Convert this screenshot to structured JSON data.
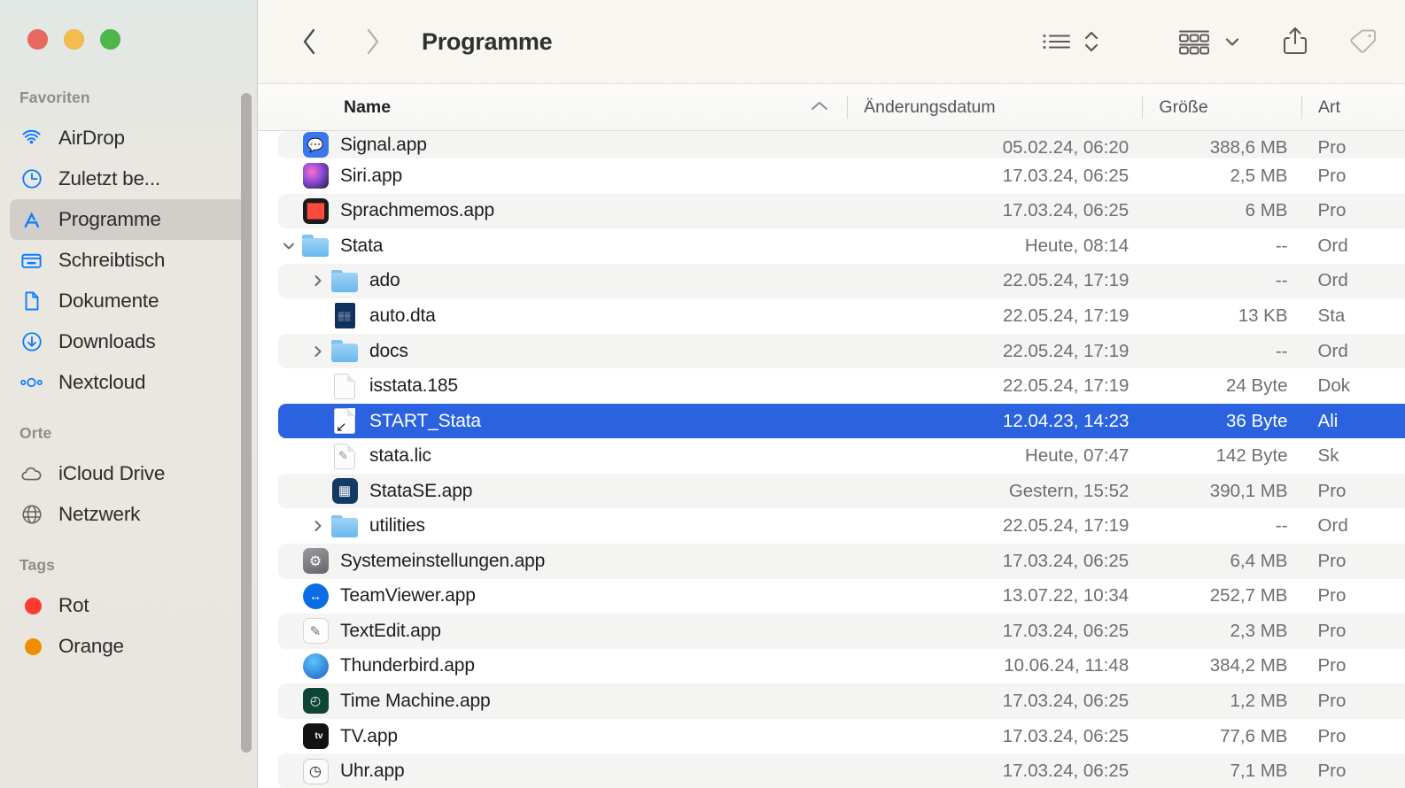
{
  "window": {
    "traffic_lights": [
      "close",
      "minimize",
      "zoom"
    ],
    "accent_selection_color": "#2a62e0",
    "sidebar_bg": "#e9e6e0",
    "toolbar_bg": "#f8f6f1"
  },
  "toolbar": {
    "back_icon": "chevron-left",
    "forward_icon": "chevron-right",
    "title": "Programme",
    "view_list_icon": "list-view-icon",
    "sort_icon": "chevron-up-down-icon",
    "group_icon": "group-by-grid-icon",
    "group_dropdown_icon": "chevron-down-icon",
    "share_icon": "share-icon",
    "tag_icon": "tag-icon"
  },
  "sidebar": {
    "sections": [
      {
        "title": "Favoriten",
        "items": [
          {
            "label": "AirDrop",
            "icon": "airdrop-icon",
            "selected": false
          },
          {
            "label": "Zuletzt be...",
            "icon": "recents-clock-icon",
            "selected": false
          },
          {
            "label": "Programme",
            "icon": "applications-icon",
            "selected": true
          },
          {
            "label": "Schreibtisch",
            "icon": "desktop-icon",
            "selected": false
          },
          {
            "label": "Dokumente",
            "icon": "documents-icon",
            "selected": false
          },
          {
            "label": "Downloads",
            "icon": "downloads-icon",
            "selected": false
          },
          {
            "label": "Nextcloud",
            "icon": "nextcloud-icon",
            "selected": false
          }
        ]
      },
      {
        "title": "Orte",
        "items": [
          {
            "label": "iCloud Drive",
            "icon": "cloud-icon",
            "selected": false
          },
          {
            "label": "Netzwerk",
            "icon": "globe-icon",
            "selected": false
          }
        ]
      },
      {
        "title": "Tags",
        "items": [
          {
            "label": "Rot",
            "icon": "tag-dot",
            "color": "#fb3b30",
            "selected": false
          },
          {
            "label": "Orange",
            "icon": "tag-dot",
            "color": "#ef8f00",
            "selected": false
          }
        ]
      }
    ]
  },
  "columns": {
    "name": "Name",
    "date": "Änderungsdatum",
    "size": "Größe",
    "kind": "Art",
    "sort_column": "Name",
    "sort_direction": "ascending"
  },
  "files": [
    {
      "name": "Signal.app",
      "date": "05.02.24, 06:20",
      "size": "388,6 MB",
      "kind": "Pro",
      "icon": "signal-app-icon",
      "indent": 0,
      "disclosure": "none",
      "selected": false,
      "clipped": true
    },
    {
      "name": "Siri.app",
      "date": "17.03.24, 06:25",
      "size": "2,5 MB",
      "kind": "Pro",
      "icon": "siri-app-icon",
      "indent": 0,
      "disclosure": "none",
      "selected": false,
      "clipped": false
    },
    {
      "name": "Sprachmemos.app",
      "date": "17.03.24, 06:25",
      "size": "6 MB",
      "kind": "Pro",
      "icon": "voicememos-app-icon",
      "indent": 0,
      "disclosure": "none",
      "selected": false,
      "clipped": false
    },
    {
      "name": "Stata",
      "date": "Heute, 08:14",
      "size": "--",
      "kind": "Ord",
      "icon": "folder-icon",
      "indent": 0,
      "disclosure": "expanded",
      "selected": false,
      "clipped": false
    },
    {
      "name": "ado",
      "date": "22.05.24, 17:19",
      "size": "--",
      "kind": "Ord",
      "icon": "folder-icon",
      "indent": 1,
      "disclosure": "collapsed",
      "selected": false,
      "clipped": false
    },
    {
      "name": "auto.dta",
      "date": "22.05.24, 17:19",
      "size": "13 KB",
      "kind": "Sta",
      "icon": "stata-data-icon",
      "indent": 1,
      "disclosure": "none",
      "selected": false,
      "clipped": false
    },
    {
      "name": "docs",
      "date": "22.05.24, 17:19",
      "size": "--",
      "kind": "Ord",
      "icon": "folder-icon",
      "indent": 1,
      "disclosure": "collapsed",
      "selected": false,
      "clipped": false
    },
    {
      "name": "isstata.185",
      "date": "22.05.24, 17:19",
      "size": "24 Byte",
      "kind": "Dok",
      "icon": "blank-document-icon",
      "indent": 1,
      "disclosure": "none",
      "selected": false,
      "clipped": false
    },
    {
      "name": "START_Stata",
      "date": "12.04.23, 14:23",
      "size": "36 Byte",
      "kind": "Ali",
      "icon": "alias-document-icon",
      "indent": 1,
      "disclosure": "none",
      "selected": true,
      "clipped": false
    },
    {
      "name": "stata.lic",
      "date": "Heute, 07:47",
      "size": "142 Byte",
      "kind": "Sk",
      "icon": "script-document-icon",
      "indent": 1,
      "disclosure": "none",
      "selected": false,
      "clipped": false
    },
    {
      "name": "StataSE.app",
      "date": "Gestern, 15:52",
      "size": "390,1 MB",
      "kind": "Pro",
      "icon": "statase-app-icon",
      "indent": 1,
      "disclosure": "none",
      "selected": false,
      "clipped": false
    },
    {
      "name": "utilities",
      "date": "22.05.24, 17:19",
      "size": "--",
      "kind": "Ord",
      "icon": "folder-icon",
      "indent": 1,
      "disclosure": "collapsed",
      "selected": false,
      "clipped": false
    },
    {
      "name": "Systemeinstellungen.app",
      "date": "17.03.24, 06:25",
      "size": "6,4 MB",
      "kind": "Pro",
      "icon": "settings-app-icon",
      "indent": 0,
      "disclosure": "none",
      "selected": false,
      "clipped": false
    },
    {
      "name": "TeamViewer.app",
      "date": "13.07.22, 10:34",
      "size": "252,7 MB",
      "kind": "Pro",
      "icon": "teamviewer-app-icon",
      "indent": 0,
      "disclosure": "none",
      "selected": false,
      "clipped": false
    },
    {
      "name": "TextEdit.app",
      "date": "17.03.24, 06:25",
      "size": "2,3 MB",
      "kind": "Pro",
      "icon": "textedit-app-icon",
      "indent": 0,
      "disclosure": "none",
      "selected": false,
      "clipped": false
    },
    {
      "name": "Thunderbird.app",
      "date": "10.06.24, 11:48",
      "size": "384,2 MB",
      "kind": "Pro",
      "icon": "thunderbird-app-icon",
      "indent": 0,
      "disclosure": "none",
      "selected": false,
      "clipped": false
    },
    {
      "name": "Time Machine.app",
      "date": "17.03.24, 06:25",
      "size": "1,2 MB",
      "kind": "Pro",
      "icon": "timemachine-app-icon",
      "indent": 0,
      "disclosure": "none",
      "selected": false,
      "clipped": false
    },
    {
      "name": "TV.app",
      "date": "17.03.24, 06:25",
      "size": "77,6 MB",
      "kind": "Pro",
      "icon": "tv-app-icon",
      "indent": 0,
      "disclosure": "none",
      "selected": false,
      "clipped": false
    },
    {
      "name": "Uhr.app",
      "date": "17.03.24, 06:25",
      "size": "7,1 MB",
      "kind": "Pro",
      "icon": "clock-app-icon",
      "indent": 0,
      "disclosure": "none",
      "selected": false,
      "clipped": false
    }
  ]
}
